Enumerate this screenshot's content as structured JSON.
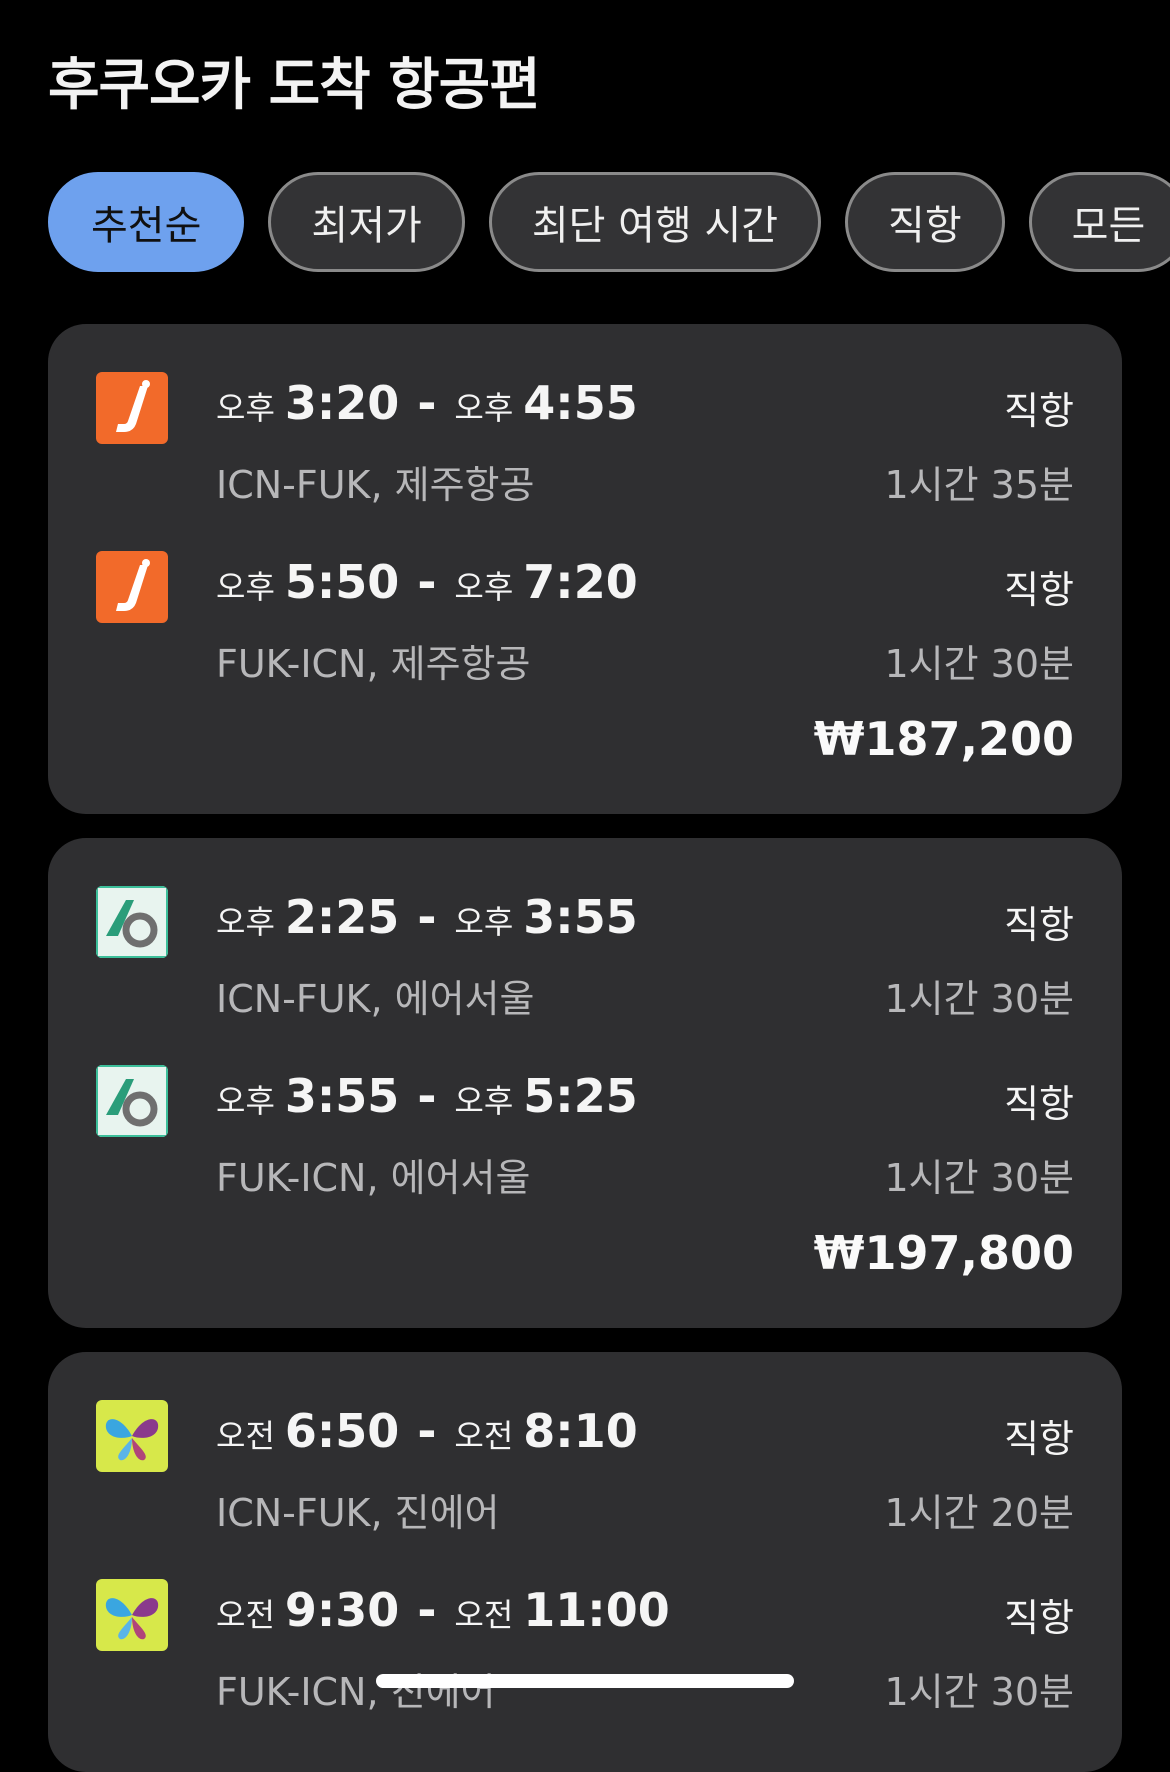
{
  "header": {
    "title": "후쿠오카 도착 항공편"
  },
  "filters": [
    {
      "label": "추천순",
      "active": true
    },
    {
      "label": "최저가",
      "active": false
    },
    {
      "label": "최단 여행 시간",
      "active": false
    },
    {
      "label": "직항",
      "active": false
    },
    {
      "label": "모든",
      "active": false
    }
  ],
  "results": [
    {
      "price": "₩187,200",
      "legs": [
        {
          "logo": "jeju-air-logo",
          "dep_ampm": "오후",
          "dep_time": "3:20",
          "arr_ampm": "오후",
          "arr_time": "4:55",
          "route": "ICN-FUK, 제주항공",
          "stops": "직항",
          "duration": "1시간 35분"
        },
        {
          "logo": "jeju-air-logo",
          "dep_ampm": "오후",
          "dep_time": "5:50",
          "arr_ampm": "오후",
          "arr_time": "7:20",
          "route": "FUK-ICN, 제주항공",
          "stops": "직항",
          "duration": "1시간 30분"
        }
      ]
    },
    {
      "price": "₩197,800",
      "legs": [
        {
          "logo": "air-seoul-logo",
          "dep_ampm": "오후",
          "dep_time": "2:25",
          "arr_ampm": "오후",
          "arr_time": "3:55",
          "route": "ICN-FUK, 에어서울",
          "stops": "직항",
          "duration": "1시간 30분"
        },
        {
          "logo": "air-seoul-logo",
          "dep_ampm": "오후",
          "dep_time": "3:55",
          "arr_ampm": "오후",
          "arr_time": "5:25",
          "route": "FUK-ICN, 에어서울",
          "stops": "직항",
          "duration": "1시간 30분"
        }
      ]
    },
    {
      "legs": [
        {
          "logo": "jin-air-logo",
          "dep_ampm": "오전",
          "dep_time": "6:50",
          "arr_ampm": "오전",
          "arr_time": "8:10",
          "route": "ICN-FUK, 진에어",
          "stops": "직항",
          "duration": "1시간 20분"
        },
        {
          "logo": "jin-air-logo",
          "dep_ampm": "오전",
          "dep_time": "9:30",
          "arr_ampm": "오전",
          "arr_time": "11:00",
          "route": "FUK-ICN, 진에어",
          "stops": "직항",
          "duration": "1시간 30분"
        }
      ]
    }
  ],
  "colors": {
    "background": "#000000",
    "card": "#2f2f31",
    "chip_active": "#6ea1ee",
    "jeju_orange": "#f26a2a",
    "air_seoul_green": "#3cbf9a",
    "jin_air_lime": "#d7e84a"
  }
}
